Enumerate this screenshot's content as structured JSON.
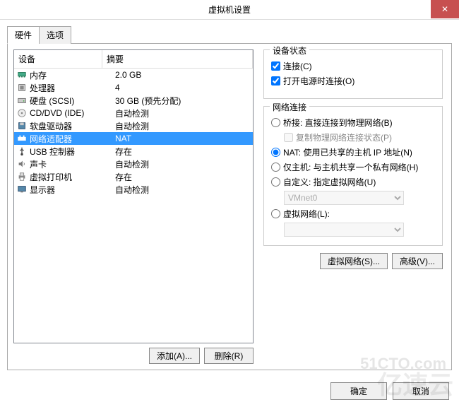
{
  "window": {
    "title": "虚拟机设置",
    "close": "✕"
  },
  "tabs": {
    "hardware": "硬件",
    "options": "选项"
  },
  "columns": {
    "device": "设备",
    "summary": "摘要"
  },
  "devices": {
    "memory": {
      "name": "内存",
      "summary": "2.0 GB",
      "icon": "memory"
    },
    "processor": {
      "name": "处理器",
      "summary": "4",
      "icon": "cpu"
    },
    "harddisk": {
      "name": "硬盘 (SCSI)",
      "summary": "30 GB (预先分配)",
      "icon": "hdd"
    },
    "cddvd": {
      "name": "CD/DVD (IDE)",
      "summary": "自动检测",
      "icon": "cd"
    },
    "floppy": {
      "name": "软盘驱动器",
      "summary": "自动检测",
      "icon": "floppy"
    },
    "network": {
      "name": "网络适配器",
      "summary": "NAT",
      "icon": "net"
    },
    "usb": {
      "name": "USB 控制器",
      "summary": "存在",
      "icon": "usb"
    },
    "sound": {
      "name": "声卡",
      "summary": "自动检测",
      "icon": "sound"
    },
    "printer": {
      "name": "虚拟打印机",
      "summary": "存在",
      "icon": "printer"
    },
    "display": {
      "name": "显示器",
      "summary": "自动检测",
      "icon": "display"
    }
  },
  "left_buttons": {
    "add": "添加(A)...",
    "remove": "删除(R)"
  },
  "device_state": {
    "title": "设备状态",
    "connected": "连接(C)",
    "connect_at_power": "打开电源时连接(O)"
  },
  "network": {
    "title": "网络连接",
    "bridged": "桥接: 直接连接到物理网络(B)",
    "replicate": "复制物理网络连接状态(P)",
    "nat": "NAT: 使用已共享的主机 IP 地址(N)",
    "hostonly": "仅主机: 与主机共享一个私有网络(H)",
    "custom": "自定义: 指定虚拟网络(U)",
    "vmnet": "VMnet0",
    "lanseg": "虚拟网络(L):"
  },
  "right_buttons": {
    "vnet": "虚拟网络(S)...",
    "advanced": "高级(V)..."
  },
  "footer": {
    "ok": "确定",
    "cancel": "取消"
  },
  "watermark": "亿速云",
  "watermark2": "51CTO.com"
}
